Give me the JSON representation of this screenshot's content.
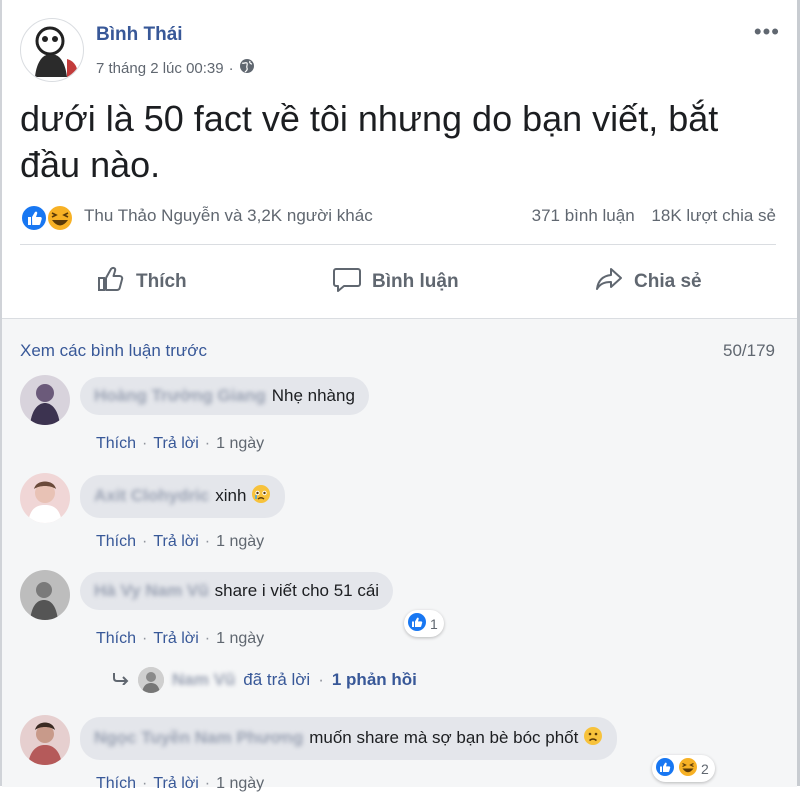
{
  "post": {
    "author": "Bình Thái",
    "timestamp": "7 tháng 2 lúc 00:39",
    "privacy_icon": "globe-icon",
    "more_label": "•••",
    "text": "dưới là 50 fact về tôi nhưng do bạn viết, bắt đầu nào."
  },
  "reactions": {
    "names": "Thu Thảo Nguyễn và 3,2K người khác",
    "comments": "371 bình luận",
    "shares": "18K lượt chia sẻ",
    "icons": [
      "like-icon",
      "haha-icon"
    ],
    "like_color": "#1877f2",
    "haha_color": "#f7b125"
  },
  "actions": {
    "like": "Thích",
    "comment": "Bình luận",
    "share": "Chia sẻ"
  },
  "comments_header": {
    "view_previous": "Xem các bình luận trước",
    "count": "50/179"
  },
  "comment_actions": {
    "like": "Thích",
    "reply": "Trả lời",
    "sep": "·"
  },
  "comments": [
    {
      "name": "Hoàng Trường Giang",
      "text": "Nhẹ nhàng",
      "time": "1 ngày"
    },
    {
      "name": "Axit Clohydric",
      "text": "xinh",
      "emoji": "crying-face-icon",
      "time": "1 ngày"
    },
    {
      "name": "Hà Vy Nam Vũ",
      "text": "share i viết cho 51 cái",
      "time": "1 ngày",
      "reaction_count": "1"
    },
    {
      "name": "Ngọc Tuyền Nam Phương",
      "text": "muốn share mà sợ bạn bè bóc phốt",
      "emoji": "frowning-face-icon",
      "time": "1 ngày",
      "reaction_count": "2"
    }
  ],
  "reply_summary": {
    "name": "Nam Vũ",
    "text": "đã trả lời",
    "sep": "·",
    "count": "1 phản hồi"
  }
}
